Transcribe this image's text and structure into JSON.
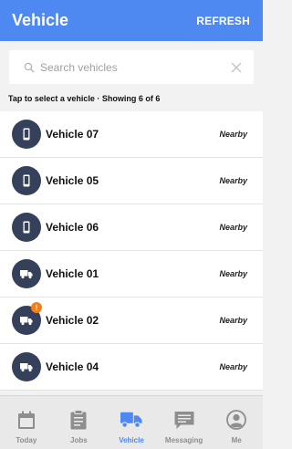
{
  "header": {
    "title": "Vehicle",
    "refresh_label": "REFRESH"
  },
  "search": {
    "placeholder": "Search vehicles",
    "value": ""
  },
  "summary": "Tap to select a vehicle · Showing 6 of 6",
  "vehicles": [
    {
      "name": "Vehicle 07",
      "status": "Nearby",
      "icon": "phone-icon",
      "alert": ""
    },
    {
      "name": "Vehicle 05",
      "status": "Nearby",
      "icon": "phone-icon",
      "alert": ""
    },
    {
      "name": "Vehicle 06",
      "status": "Nearby",
      "icon": "phone-icon",
      "alert": ""
    },
    {
      "name": "Vehicle 01",
      "status": "Nearby",
      "icon": "truck-icon",
      "alert": ""
    },
    {
      "name": "Vehicle 02",
      "status": "Nearby",
      "icon": "truck-icon",
      "alert": "!"
    },
    {
      "name": "Vehicle 04",
      "status": "Nearby",
      "icon": "truck-icon",
      "alert": ""
    }
  ],
  "tabs": [
    {
      "label": "Today",
      "icon": "calendar-icon",
      "active": false
    },
    {
      "label": "Jobs",
      "icon": "clipboard-icon",
      "active": false
    },
    {
      "label": "Vehicle",
      "icon": "truck-icon",
      "active": true
    },
    {
      "label": "Messaging",
      "icon": "message-icon",
      "active": false
    },
    {
      "label": "Me",
      "icon": "person-icon",
      "active": false
    }
  ],
  "colors": {
    "accent": "#4d89f1",
    "avatar": "#35415a",
    "alert": "#f07f18",
    "tab_inactive": "#8e8e8e"
  }
}
